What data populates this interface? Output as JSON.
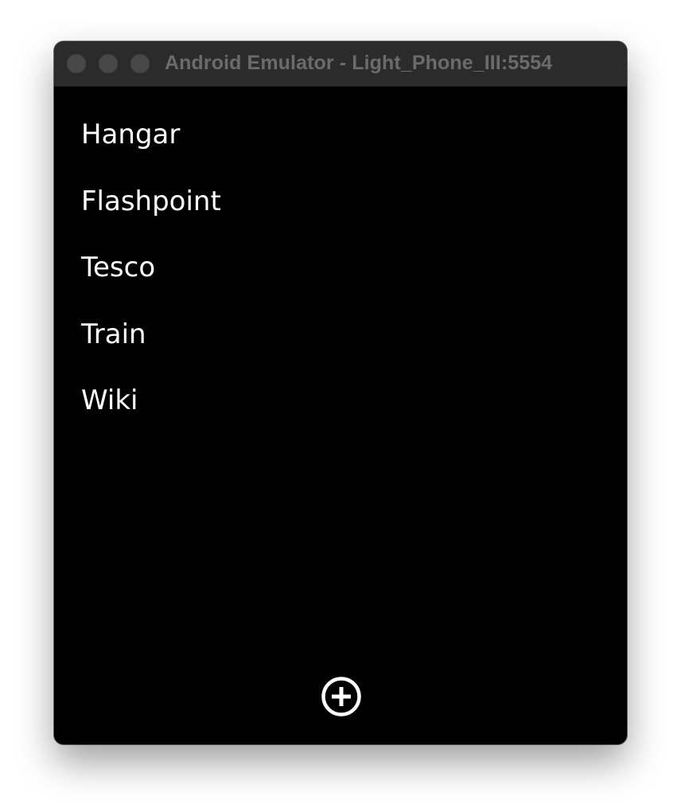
{
  "window": {
    "title": "Android Emulator - Light_Phone_III:5554"
  },
  "apps": [
    {
      "label": "Hangar"
    },
    {
      "label": "Flashpoint"
    },
    {
      "label": "Tesco"
    },
    {
      "label": "Train"
    },
    {
      "label": "Wiki"
    }
  ],
  "add_button": {
    "icon": "plus-circle-icon"
  },
  "colors": {
    "screen_background": "#000000",
    "text": "#ffffff",
    "titlebar": "#2b2b2b",
    "title_text": "#6b6b6b"
  }
}
